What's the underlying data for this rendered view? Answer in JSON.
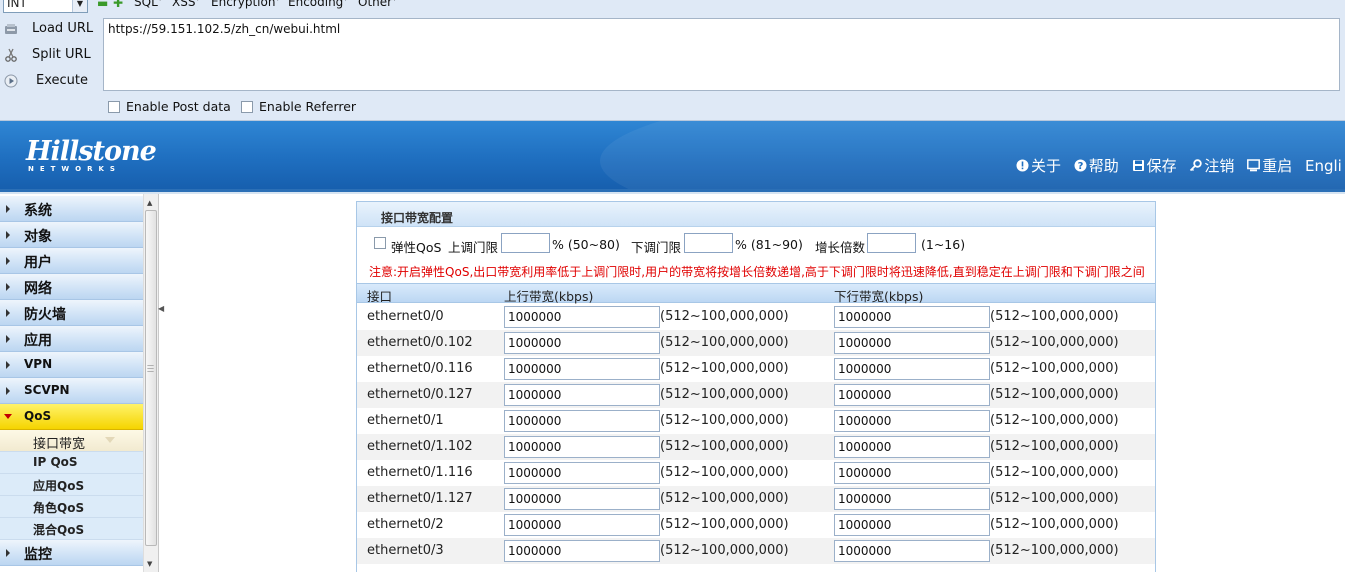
{
  "hackbar": {
    "select_value": "INT",
    "menus": [
      "SQL",
      "XSS",
      "Encryption",
      "Encoding",
      "Other"
    ],
    "buttons": {
      "load": "Load URL",
      "split": "Split URL",
      "execute": "Execute"
    },
    "url": "https://59.151.102.5/zh_cn/webui.html",
    "checks": {
      "post": "Enable Post data",
      "referrer": "Enable Referrer"
    }
  },
  "header": {
    "logo": "Hillstone",
    "logo_sub": "NETWORKS",
    "links": {
      "about": "关于",
      "help": "帮助",
      "save": "保存",
      "logout": "注销",
      "restart": "重启",
      "lang": "Engli"
    }
  },
  "nav": {
    "items": [
      "系统",
      "对象",
      "用户",
      "网络",
      "防火墙",
      "应用",
      "VPN",
      "SCVPN"
    ],
    "active": "QoS",
    "sub_items": [
      "接口带宽",
      "IP QoS",
      "应用QoS",
      "角色QoS",
      "混合QoS"
    ],
    "after": "监控"
  },
  "panel": {
    "title": "接口带宽配置",
    "qos": {
      "elastic": "弹性QoS",
      "upper_label": "上调门限",
      "upper_range": "% (50~80)",
      "lower_label": "下调门限",
      "lower_range": "% (81~90)",
      "growth_label": "增长倍数",
      "growth_range": "(1~16)"
    },
    "notice": "注意:开启弹性QoS,出口带宽利用率低于上调门限时,用户的带宽将按增长倍数递增,高于下调门限时将迅速降低,直到稳定在上调门限和下调门限之间",
    "columns": {
      "iface": "接口",
      "up": "上行带宽(kbps)",
      "down": "下行带宽(kbps)"
    },
    "range_text": "(512~100,000,000)",
    "rows": [
      {
        "iface": "ethernet0/0",
        "up": "1000000",
        "down": "1000000"
      },
      {
        "iface": "ethernet0/0.102",
        "up": "1000000",
        "down": "1000000"
      },
      {
        "iface": "ethernet0/0.116",
        "up": "1000000",
        "down": "1000000"
      },
      {
        "iface": "ethernet0/0.127",
        "up": "1000000",
        "down": "1000000"
      },
      {
        "iface": "ethernet0/1",
        "up": "1000000",
        "down": "1000000"
      },
      {
        "iface": "ethernet0/1.102",
        "up": "1000000",
        "down": "1000000"
      },
      {
        "iface": "ethernet0/1.116",
        "up": "1000000",
        "down": "1000000"
      },
      {
        "iface": "ethernet0/1.127",
        "up": "1000000",
        "down": "1000000"
      },
      {
        "iface": "ethernet0/2",
        "up": "1000000",
        "down": "1000000"
      },
      {
        "iface": "ethernet0/3",
        "up": "1000000",
        "down": "1000000"
      }
    ]
  }
}
